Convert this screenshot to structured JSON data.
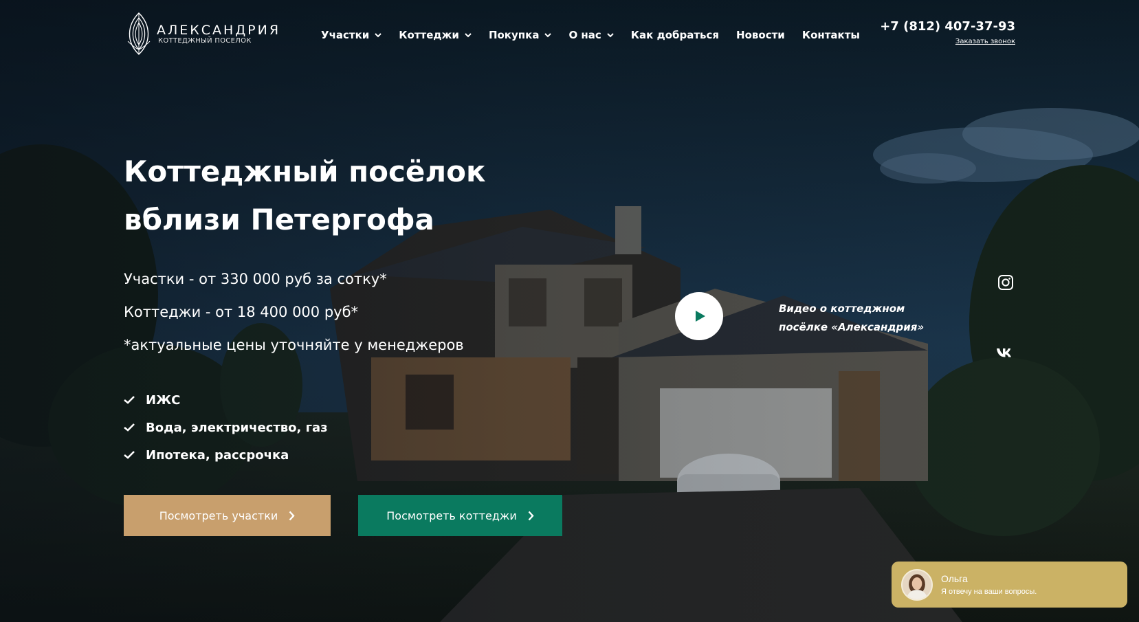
{
  "logo": {
    "title": "АЛЕКСАНДРИЯ",
    "subtitle": "КОТТЕДЖНЫЙ ПОСЕЛОК",
    "icon": "leaf-logo-icon"
  },
  "nav": {
    "items": [
      {
        "label": "Участки",
        "dropdown": true
      },
      {
        "label": "Коттеджи",
        "dropdown": true
      },
      {
        "label": "Покупка",
        "dropdown": true
      },
      {
        "label": "О нас",
        "dropdown": true
      },
      {
        "label": "Как добраться",
        "dropdown": false
      },
      {
        "label": "Новости",
        "dropdown": false
      },
      {
        "label": "Контакты",
        "dropdown": false
      }
    ]
  },
  "contact": {
    "phone": "+7 (812) 407-37-93",
    "callback_label": "Заказать звонок"
  },
  "hero": {
    "title_line1": "Коттеджный посёлок",
    "title_line2": "вблизи Петергофа",
    "lines": [
      "Участки - от 330 000 руб за сотку*",
      "Коттеджи - от 18 400 000 руб*",
      "*актуальные цены уточняйте у менеджеров"
    ],
    "features": [
      "ИЖС",
      "Вода, электричество, газ",
      "Ипотека, рассрочка"
    ]
  },
  "buttons": {
    "plots_label": "Посмотреть участки",
    "cottages_label": "Посмотреть коттеджи"
  },
  "video": {
    "caption_line1": "Видео о коттеджном",
    "caption_line2": "посёлке «Александрия»"
  },
  "social": {
    "instagram_icon": "instagram-icon",
    "vk_icon": "vk-icon"
  },
  "chat": {
    "name": "Ольга",
    "message": "Я отвечу на ваши вопросы."
  },
  "colors": {
    "plots_button": "#c89f6d",
    "cottages_button": "#0a7a5f",
    "chat_background": "#cbb265"
  }
}
